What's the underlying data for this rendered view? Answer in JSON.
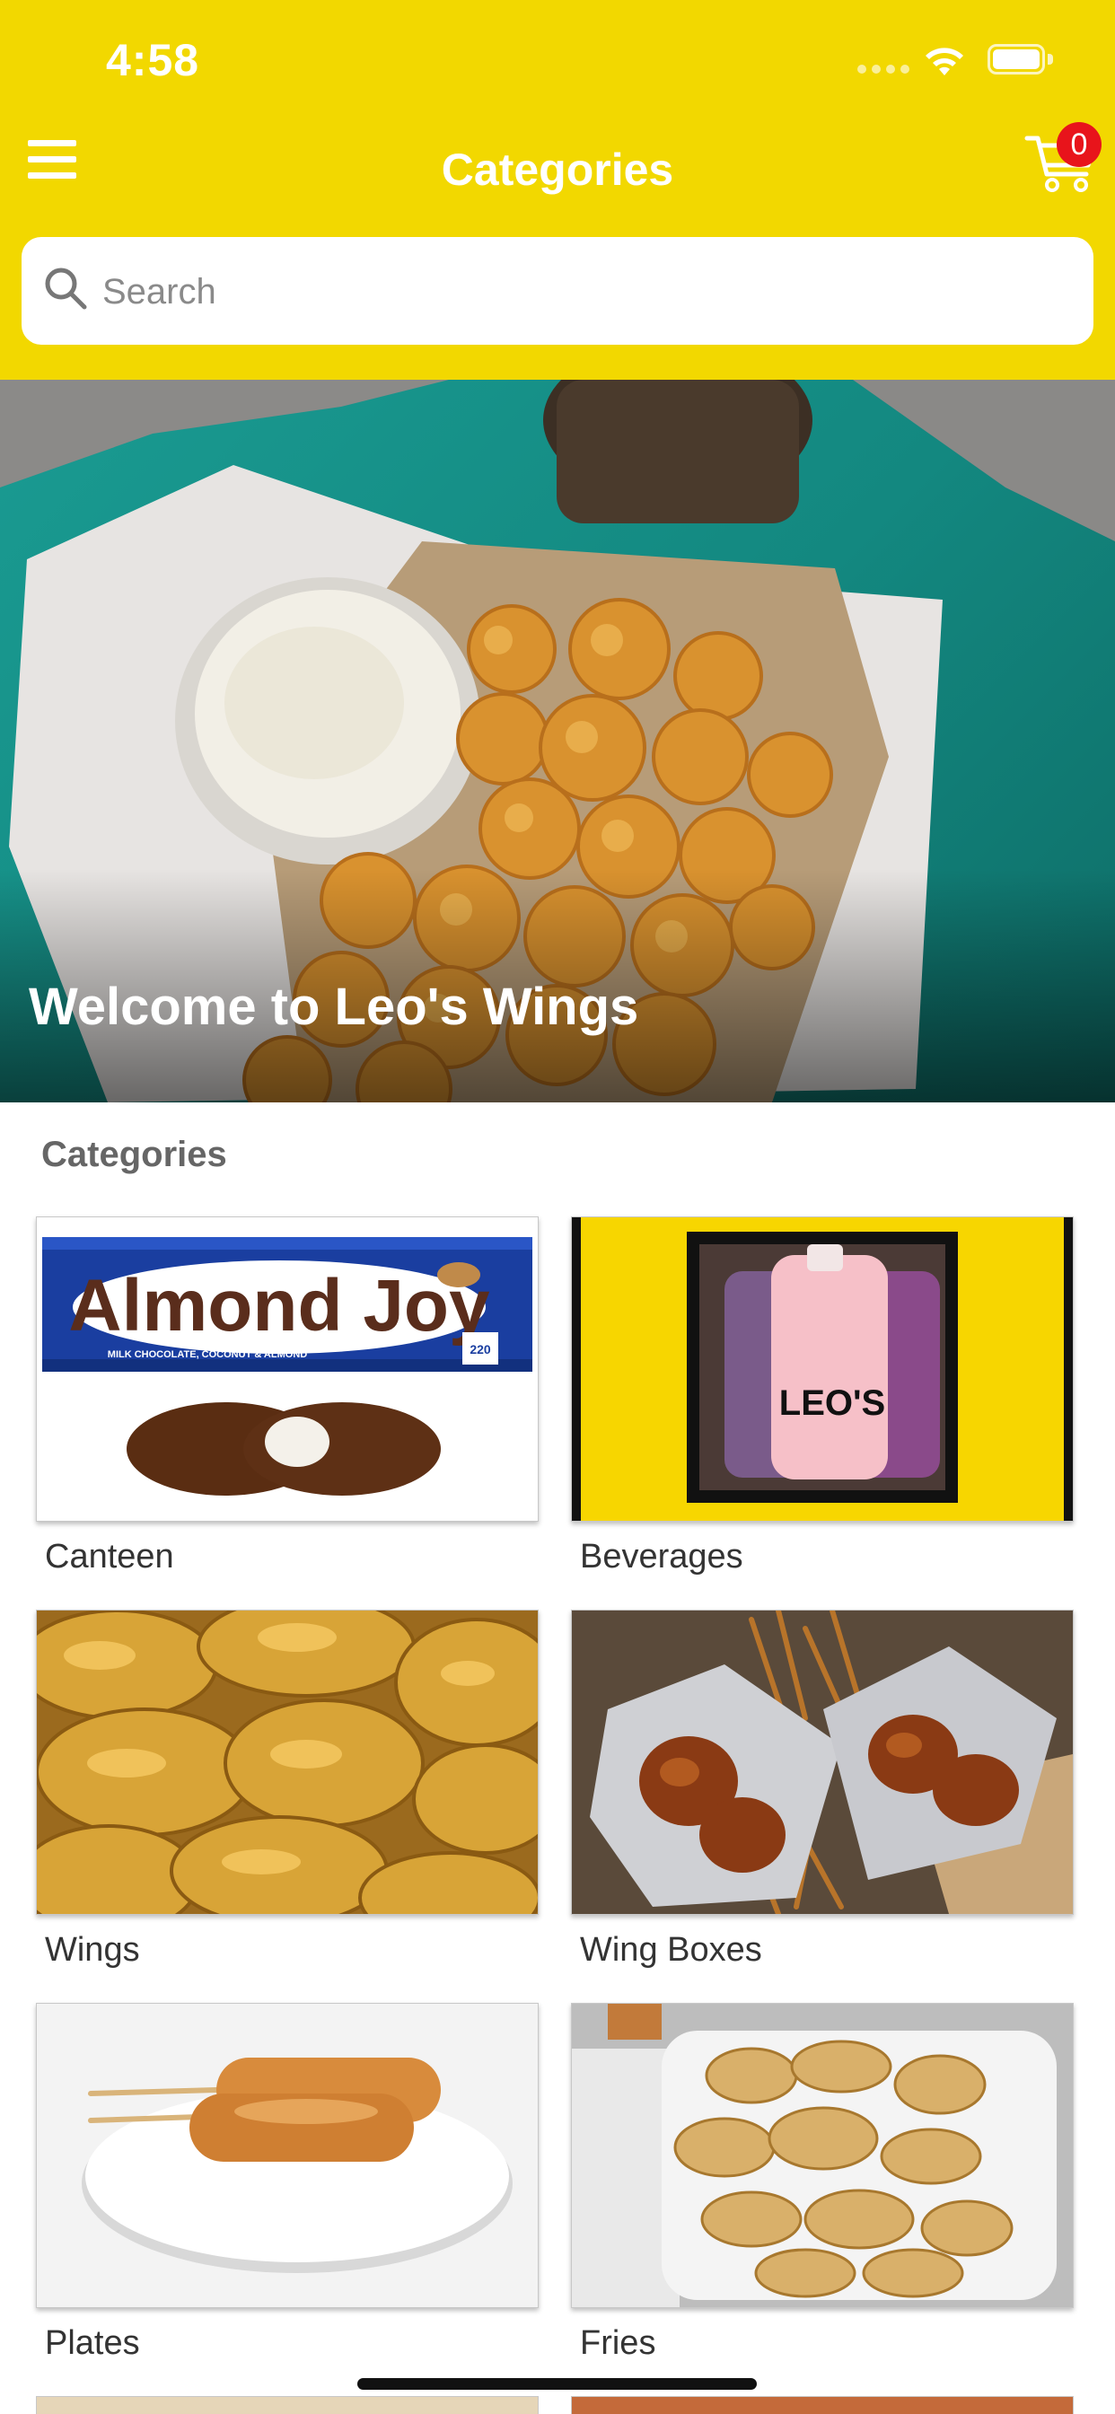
{
  "status_bar": {
    "time": "4:58"
  },
  "nav": {
    "title": "Categories",
    "menu_icon": "hamburger-menu-icon",
    "cart_icon": "shopping-cart-icon",
    "cart_count": "0"
  },
  "search": {
    "placeholder": "Search",
    "value": ""
  },
  "hero": {
    "title": "Welcome to Leo's Wings"
  },
  "categories": {
    "heading": "Categories",
    "items": [
      {
        "label": "Canteen",
        "image_text": "Almond Joy",
        "image_subtext": "MILK CHOCOLATE, COCONUT & ALMOND",
        "image_badge": "220"
      },
      {
        "label": "Beverages",
        "image_text": "LEO'S"
      },
      {
        "label": "Wings"
      },
      {
        "label": "Wing Boxes"
      },
      {
        "label": "Plates"
      },
      {
        "label": "Fries"
      }
    ]
  },
  "colors": {
    "header_bg": "#f2d800",
    "badge_bg": "#e8141b",
    "hero_tray": "#1a9b92"
  }
}
